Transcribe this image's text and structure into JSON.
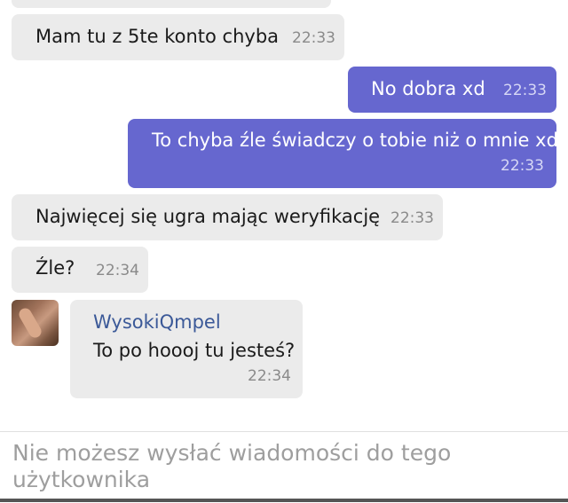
{
  "conversation": {
    "messages": [
      {
        "direction": "in",
        "text": "Mam tu z 5te konto chyba",
        "time": "22:33"
      },
      {
        "direction": "out",
        "text": "No dobra xd",
        "time": "22:33"
      },
      {
        "direction": "out",
        "text": "To chyba źle świadczy o tobie niż o mnie xd",
        "time": "22:33"
      },
      {
        "direction": "in",
        "text": "Najwięcej się ugra mając weryfikację",
        "time": "22:33"
      },
      {
        "direction": "in",
        "text": "Źle?",
        "time": "22:34"
      },
      {
        "direction": "in",
        "sender": "WysokiQmpel",
        "text": "To po hoooj tu jesteś?",
        "time": "22:34"
      }
    ]
  },
  "composer": {
    "disabled_text": "Nie możesz wysłać wiadomości do tego użytkownika"
  },
  "colors": {
    "incoming_bubble": "#ebebeb",
    "outgoing_bubble": "#6667cf",
    "sender_name": "#3b5998"
  }
}
